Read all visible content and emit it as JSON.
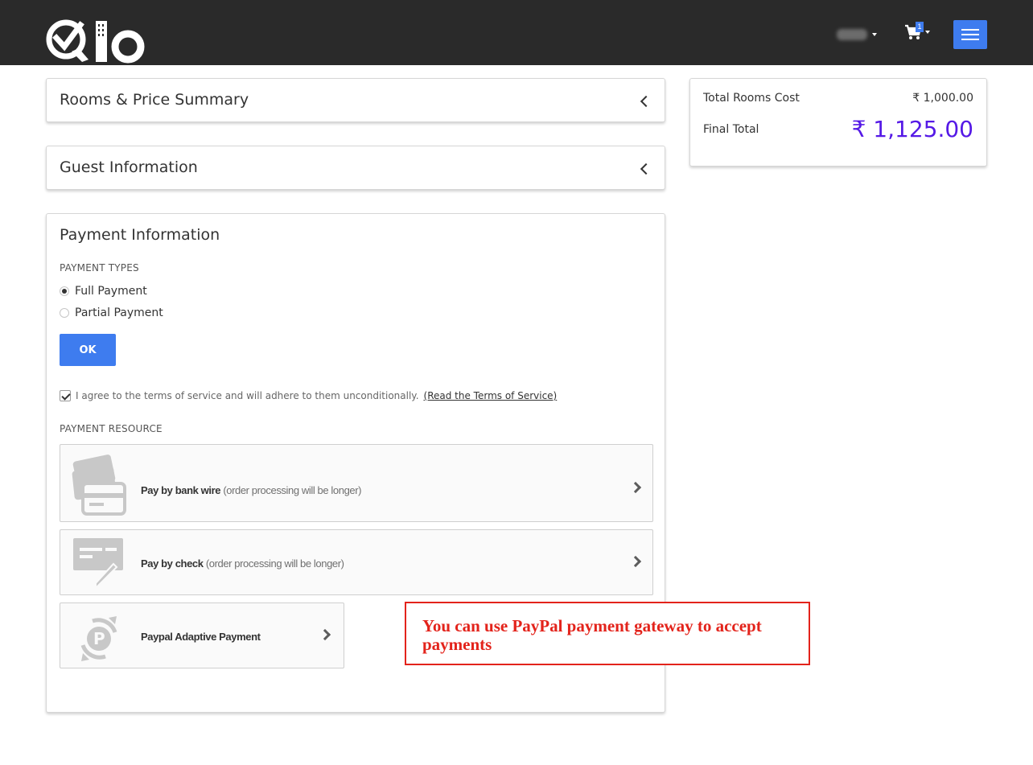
{
  "header": {
    "logo_text": "Qlo",
    "cart_count": "1",
    "menu_label": "Menu"
  },
  "rooms_panel": {
    "title": "Rooms & Price Summary"
  },
  "guest_panel": {
    "title": "Guest Information"
  },
  "payment_panel": {
    "title": "Payment Information",
    "payment_types_label": "PAYMENT TYPES",
    "options": [
      {
        "label": "Full Payment",
        "selected": true
      },
      {
        "label": "Partial Payment",
        "selected": false
      }
    ],
    "ok_label": "OK",
    "terms_text": "I agree to the terms of service and will adhere to them unconditionally.",
    "terms_link": "(Read the Terms of Service)",
    "terms_checked": true,
    "resource_label": "PAYMENT RESOURCE",
    "methods": [
      {
        "title": "Pay by bank wire",
        "note": "(order processing will be longer)",
        "icon": "bank-card-icon"
      },
      {
        "title": "Pay by check",
        "note": "(order processing will be longer)",
        "icon": "check-pen-icon"
      },
      {
        "title": "Paypal Adaptive Payment",
        "note": "",
        "icon": "paypal-icon"
      }
    ]
  },
  "summary": {
    "rows": [
      {
        "label": "Total Rooms Cost",
        "value": "₹ 1,000.00"
      },
      {
        "label": "Final Total",
        "value": "₹ 1,125.00"
      }
    ]
  },
  "annotation": {
    "text": "You can use PayPal payment gateway to accept payments"
  },
  "colors": {
    "accent": "#3e7cef",
    "total": "#5519e6",
    "annotation": "#e3231b",
    "topbar": "#2a2a2a"
  }
}
